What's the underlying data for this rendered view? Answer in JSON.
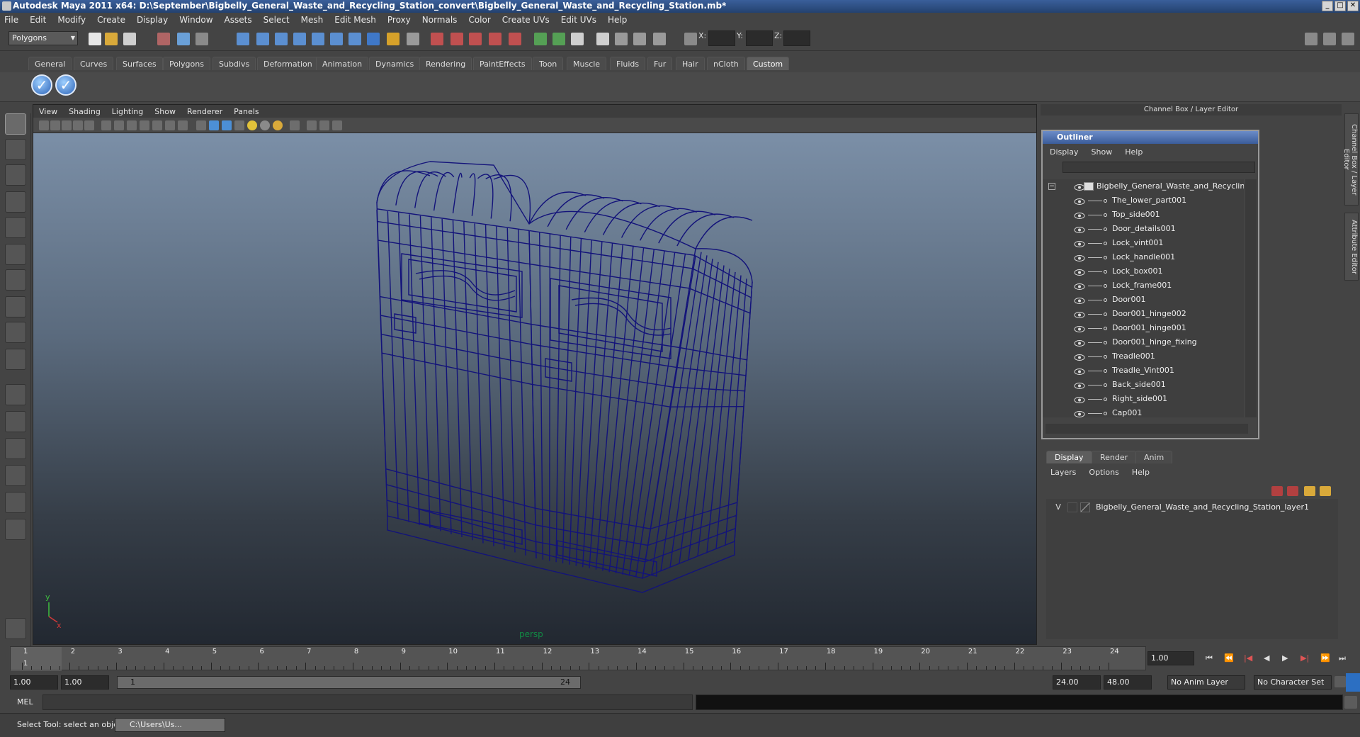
{
  "window": {
    "title": "Autodesk Maya 2011 x64: D:\\September\\Bigbelly_General_Waste_and_Recycling_Station_convert\\Bigbelly_General_Waste_and_Recycling_Station.mb*"
  },
  "menubar": [
    "File",
    "Edit",
    "Modify",
    "Create",
    "Display",
    "Window",
    "Assets",
    "Select",
    "Mesh",
    "Edit Mesh",
    "Proxy",
    "Normals",
    "Color",
    "Create UVs",
    "Edit UVs",
    "Help"
  ],
  "statusline": {
    "mode": "Polygons",
    "x_label": "X:",
    "y_label": "Y:",
    "z_label": "Z:"
  },
  "shelf_tabs": [
    "General",
    "Curves",
    "Surfaces",
    "Polygons",
    "Subdivs",
    "Deformation",
    "Animation",
    "Dynamics",
    "Rendering",
    "PaintEffects",
    "Toon",
    "Muscle",
    "Fluids",
    "Fur",
    "Hair",
    "nCloth",
    "Custom"
  ],
  "shelf_active": "Custom",
  "viewport": {
    "menu": [
      "View",
      "Shading",
      "Lighting",
      "Show",
      "Renderer",
      "Panels"
    ],
    "camera_label": "persp",
    "axis_y": "y",
    "axis_x": "x",
    "wire_color": "#13137a"
  },
  "channel_box": {
    "title": "Channel Box / Layer Editor"
  },
  "side_tabs": [
    "Channel Box / Layer Editor",
    "Attribute Editor"
  ],
  "outliner": {
    "title": "Outliner",
    "menu": [
      "Display",
      "Show",
      "Help"
    ],
    "root": "Bigbelly_General_Waste_and_Recycling_Sta",
    "children": [
      "The_lower_part001",
      "Top_side001",
      "Door_details001",
      "Lock_vint001",
      "Lock_handle001",
      "Lock_box001",
      "Lock_frame001",
      "Door001",
      "Door001_hinge002",
      "Door001_hinge001",
      "Door001_hinge_fixing",
      "Treadle001",
      "Treadle_Vint001",
      "Back_side001",
      "Right_side001",
      "Cap001"
    ]
  },
  "layer_editor": {
    "tabs": [
      "Display",
      "Render",
      "Anim"
    ],
    "active_tab": "Display",
    "menu": [
      "Layers",
      "Options",
      "Help"
    ],
    "layer_visible": "V",
    "layer_name": "Bigbelly_General_Waste_and_Recycling_Station_layer1"
  },
  "timeline": {
    "ticks": [
      1,
      2,
      3,
      4,
      5,
      6,
      7,
      8,
      9,
      10,
      11,
      12,
      13,
      14,
      15,
      16,
      17,
      18,
      19,
      20,
      21,
      22,
      23,
      24
    ],
    "current_frame": "1",
    "current_time_field": "1.00"
  },
  "range": {
    "start": "1.00",
    "playback_start": "1.00",
    "slider_start": "1",
    "slider_end": "24",
    "playback_end": "24.00",
    "end": "48.00",
    "anim_layer": "No Anim Layer",
    "character_set": "No Character Set"
  },
  "command": {
    "language": "MEL"
  },
  "help_line": {
    "text": "Select Tool: select an object",
    "task_button": "C:\\Users\\Us..."
  }
}
